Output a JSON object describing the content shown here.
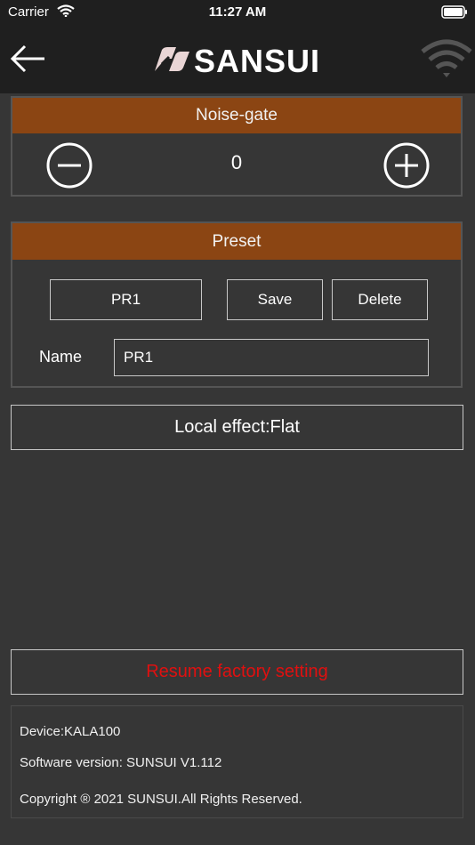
{
  "status_bar": {
    "carrier": "Carrier",
    "time": "11:27 AM"
  },
  "header": {
    "brand": "SANSUI",
    "icons": [
      "back-arrow-icon",
      "wifi-icon"
    ]
  },
  "noise_gate": {
    "title": "Noise-gate",
    "value": "0"
  },
  "preset": {
    "title": "Preset",
    "selected": "PR1",
    "save_label": "Save",
    "delete_label": "Delete",
    "name_label": "Name",
    "name_value": "PR1"
  },
  "local_effect_label": "Local effect:Flat",
  "resume_label": "Resume factory setting",
  "info": {
    "device": "Device:KALA100",
    "software": "Software version: SUNSUI V1.112",
    "copyright": "Copyright ® 2021 SUNSUI.All Rights Reserved."
  },
  "colors": {
    "header_orange": "#8b4513",
    "background": "#363636",
    "bar": "#1f1f1f",
    "resume_red": "#e01010"
  }
}
